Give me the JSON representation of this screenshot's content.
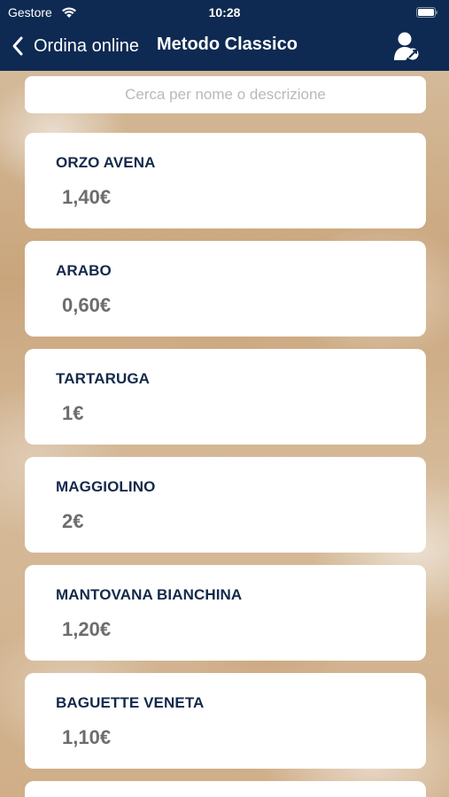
{
  "status_bar": {
    "carrier": "Gestore",
    "time": "10:28"
  },
  "nav": {
    "back_label": "Ordina online",
    "title": "Metodo Classico",
    "icons": [
      "chevron-left-icon",
      "user-profile-icon"
    ]
  },
  "search": {
    "placeholder": "Cerca per nome o descrizione",
    "value": ""
  },
  "products": [
    {
      "name": "ORZO AVENA",
      "price": "1,40€"
    },
    {
      "name": "ARABO",
      "price": "0,60€"
    },
    {
      "name": "TARTARUGA",
      "price": "1€"
    },
    {
      "name": "MAGGIOLINO",
      "price": "2€"
    },
    {
      "name": "MANTOVANA BIANCHINA",
      "price": "1,20€"
    },
    {
      "name": "BAGUETTE VENETA",
      "price": "1,10€"
    }
  ],
  "colors": {
    "nav_background": "#0e2a52",
    "product_name": "#13294b",
    "product_price": "#6d6d6d",
    "card_background": "#ffffff"
  }
}
